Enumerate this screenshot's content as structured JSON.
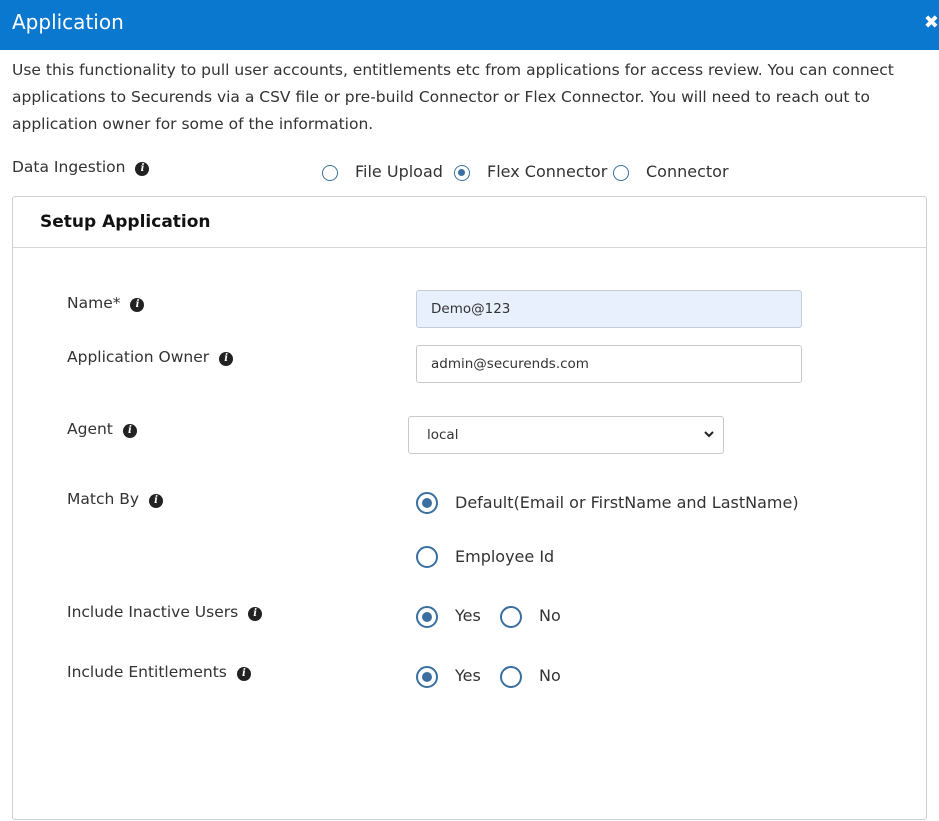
{
  "header": {
    "title": "Application",
    "close": "✖"
  },
  "description": "Use this functionality to pull user accounts, entitlements etc from applications for access review. You can connect applications to Securends via a CSV file or pre-build Connector or Flex Connector. You will need to reach out to application owner for some of the information.",
  "data_ingestion": {
    "label": "Data Ingestion",
    "options": [
      "File Upload",
      "Flex Connector",
      "Connector"
    ],
    "selected": "Flex Connector"
  },
  "setup": {
    "title": "Setup Application",
    "name": {
      "label": "Name*",
      "value": "Demo@123"
    },
    "owner": {
      "label": "Application Owner",
      "value": "admin@securends.com"
    },
    "agent": {
      "label": "Agent",
      "value": "local"
    },
    "match_by": {
      "label": "Match By",
      "options": [
        "Default(Email or FirstName and LastName)",
        "Employee Id"
      ],
      "selected": "Default(Email or FirstName and LastName)"
    },
    "inactive_users": {
      "label": "Include Inactive Users",
      "options": [
        "Yes",
        "No"
      ],
      "selected": "Yes"
    },
    "entitlements": {
      "label": "Include Entitlements",
      "options": [
        "Yes",
        "No"
      ],
      "selected": "Yes"
    }
  },
  "colors": {
    "header": "#0b78d0",
    "radio": "#3a6fa0",
    "autofill": "#e8f0fe"
  },
  "icons": {
    "info": "info-icon",
    "close": "close-icon",
    "select_arrow": "chevron-down-icon"
  }
}
